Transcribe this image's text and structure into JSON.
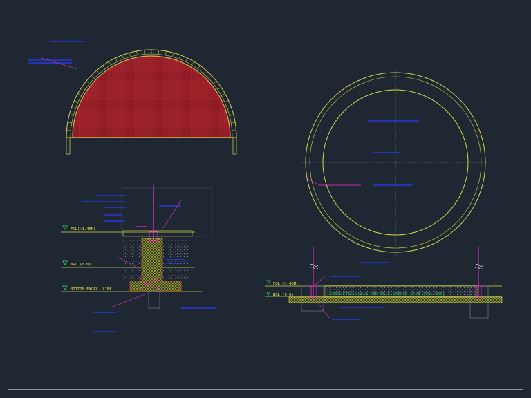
{
  "drawing": {
    "background": "#1f2733",
    "border_color": "#8a94a4",
    "colors": {
      "yellow": "#d6d64a",
      "red": "#a8202a",
      "magenta": "#ff2bd5",
      "blue": "#2a3cff",
      "green": "#2fd35a",
      "grey": "#7d8696",
      "white": "#e8e8e8"
    }
  },
  "section_detail": {
    "levels": {
      "fgl": "FGL(+1.40M)",
      "ngl": "NGL (0.0)",
      "bottom": "BOTTOM EXCAV. LINE"
    }
  },
  "ring_section": {
    "levels": {
      "fgl": "FGL(+1.40M)",
      "ngl": "NGL (0.0)"
    },
    "fill_note": "COMPACTED CLEAN AND WELL GRADED SAND (98% MDD)"
  }
}
